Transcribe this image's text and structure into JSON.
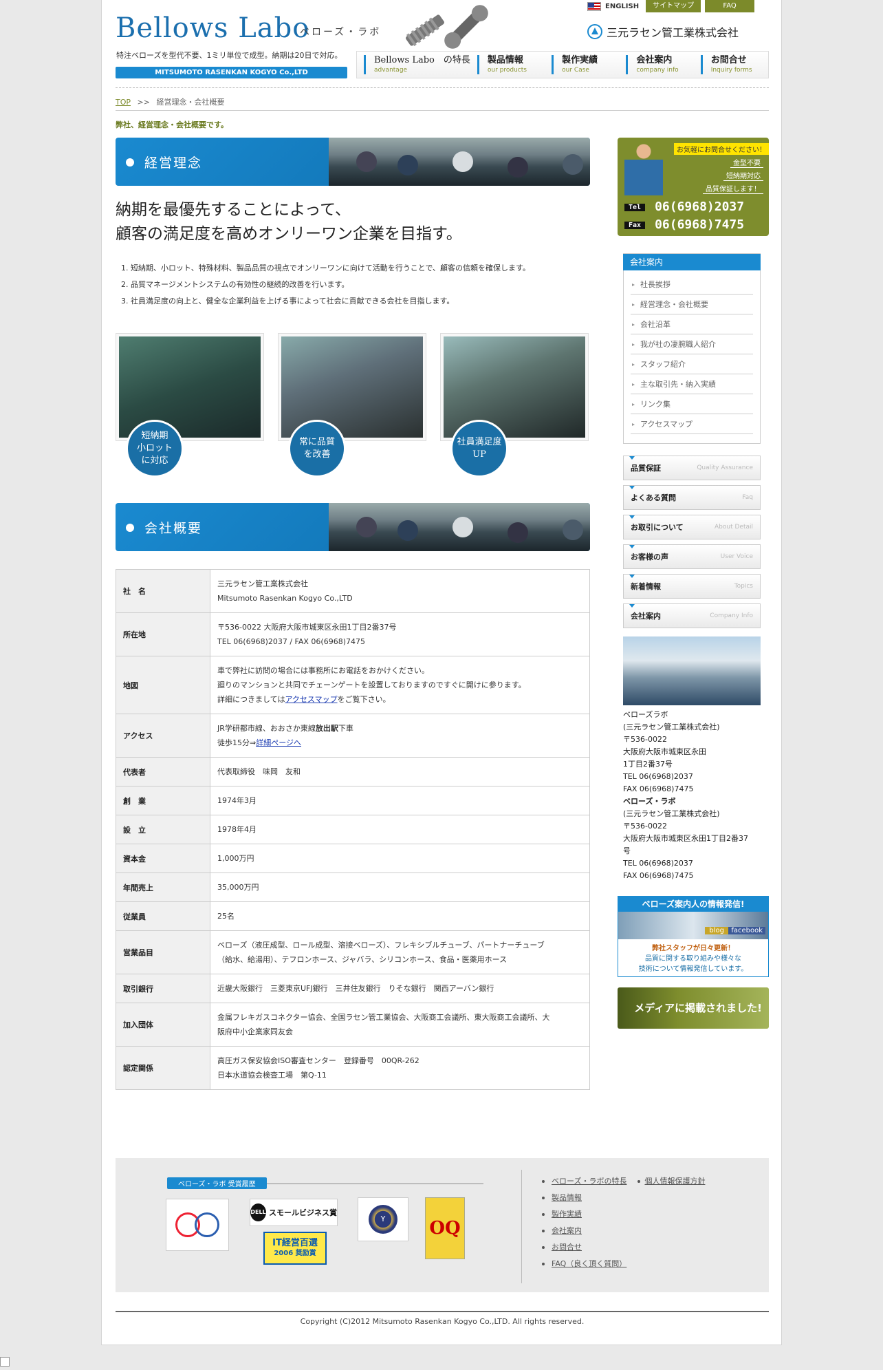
{
  "header": {
    "logo": "Bellows Labo",
    "logo_kana": "ベローズ・ラボ",
    "tagline": "特注ベローズを型代不要、1ミリ単位で成型。納期は20日で対応。",
    "company_en": "MITSUMOTO RASENKAN KOGYO Co.,LTD",
    "company_jp": "三元ラセン管工業株式会社",
    "top_links": {
      "english": "ENGLISH",
      "sitemap": "サイトマップ",
      "faq": "FAQ"
    },
    "nav": [
      {
        "jp": "Bellows Labo　の特長",
        "en": "advantage"
      },
      {
        "jp": "製品情報",
        "en": "our products"
      },
      {
        "jp": "製作実績",
        "en": "our Case"
      },
      {
        "jp": "会社案内",
        "en": "company info"
      },
      {
        "jp": "お問合せ",
        "en": "Inquiry forms"
      }
    ]
  },
  "breadcrumb": {
    "top": "TOP",
    "sep": ">>",
    "current": "経営理念・会社概要"
  },
  "intro": "弊社、経営理念・会社概要です。",
  "philosophy": {
    "heading": "経営理念",
    "title_line1": "納期を最優先することによって、",
    "title_line2": "顧客の満足度を高めオンリーワン企業を目指す。",
    "items": [
      "短納期、小ロット、特殊材料、製品品質の視点でオンリーワンに向けて活動を行うことで、顧客の信頼を確保します。",
      "品質マネージメントシステムの有効性の継続的改善を行います。",
      "社員満足度の向上と、健全な企業利益を上げる事によって社会に貢献できる会社を目指します。"
    ],
    "cards": [
      {
        "badge": "短納期\n小ロット\nに対応"
      },
      {
        "badge": "常に品質\nを改善"
      },
      {
        "badge": "社員満足度\nUP"
      }
    ]
  },
  "overview": {
    "heading": "会社概要",
    "rows": [
      {
        "label": "社　名",
        "lines": [
          "三元ラセン管工業株式会社",
          "Mitsumoto Rasenkan Kogyo Co.,LTD"
        ]
      },
      {
        "label": "所在地",
        "lines": [
          "〒536-0022 大阪府大阪市城東区永田1丁目2番37号",
          "TEL 06(6968)2037 / FAX 06(6968)7475"
        ]
      },
      {
        "label": "地図",
        "lines": [
          "車で弊社に訪問の場合には事務所にお電話をおかけください。",
          "廻りのマンションと共同でチェーンゲートを設置しておりますのですぐに開けに参ります。"
        ],
        "pre": "詳細につきましては",
        "link": "アクセスマップ",
        "post": "をご覧下さい。"
      },
      {
        "label": "アクセス",
        "line1_a": "JR学研都市線、おおさか東線",
        "line1_b": "放出駅",
        "line1_c": "下車",
        "line2_pre": "徒歩15分⇒",
        "line2_link": "詳細ページへ"
      },
      {
        "label": "代表者",
        "lines": [
          "代表取締役　味岡　友和"
        ]
      },
      {
        "label": "創　業",
        "lines": [
          "1974年3月"
        ]
      },
      {
        "label": "設　立",
        "lines": [
          "1978年4月"
        ]
      },
      {
        "label": "資本金",
        "lines": [
          "1,000万円"
        ]
      },
      {
        "label": "年間売上",
        "lines": [
          "35,000万円"
        ]
      },
      {
        "label": "従業員",
        "lines": [
          "25名"
        ]
      },
      {
        "label": "営業品目",
        "lines": [
          "ベローズ（液圧成型、ロール成型、溶接ベローズ）、フレキシブルチューブ、パートナーチューブ",
          "（給水、給湯用）、テフロンホース、ジャバラ、シリコンホース、食品・医薬用ホース"
        ]
      },
      {
        "label": "取引銀行",
        "lines": [
          "近畿大阪銀行　三菱東京UFJ銀行　三井住友銀行　りそな銀行　関西アーバン銀行"
        ]
      },
      {
        "label": "加入団体",
        "lines": [
          "金属フレキガスコネクター協会、全国ラセン管工業協会、大阪商工会議所、東大阪商工会議所、大",
          "阪府中小企業家同友会"
        ]
      },
      {
        "label": "認定関係",
        "lines": [
          "高圧ガス保安協会ISO審査センター　登録番号　00QR-262",
          "日本水道協会検査工場　第Q-11"
        ]
      }
    ]
  },
  "sidebar": {
    "contact": {
      "bubble": "お気軽にお問合せください！",
      "tags": [
        "金型不要",
        "短納期対応",
        "品質保証します！"
      ],
      "tel_label": "Tel",
      "tel": "06(6968)2037",
      "fax_label": "Fax",
      "fax": "06(6968)7475"
    },
    "subnav_title": "会社案内",
    "subnav": [
      "社長挨拶",
      "経営理念・会社概要",
      "会社沿革",
      "我が社の凄腕職人紹介",
      "スタッフ紹介",
      "主な取引先・納入実績",
      "リンク集",
      "アクセスマップ"
    ],
    "buttons": [
      {
        "jp": "品質保証",
        "en": "Quality Assurance"
      },
      {
        "jp": "よくある質問",
        "en": "Faq"
      },
      {
        "jp": "お取引について",
        "en": "About Detail"
      },
      {
        "jp": "お客様の声",
        "en": "User Voice"
      },
      {
        "jp": "新着情報",
        "en": "Topics"
      },
      {
        "jp": "会社案内",
        "en": "Company Info"
      }
    ],
    "address": [
      {
        "t": "ベローズラボ",
        "b": false
      },
      {
        "t": "(三元ラセン管工業株式会社)",
        "b": false
      },
      {
        "t": "〒536-0022",
        "b": false
      },
      {
        "t": "大阪府大阪市城東区永田",
        "b": false
      },
      {
        "t": "1丁目2番37号",
        "b": false
      },
      {
        "t": "TEL 06(6968)2037",
        "b": false
      },
      {
        "t": "FAX 06(6968)7475",
        "b": false
      },
      {
        "t": "ベローズ・ラボ",
        "b": true
      },
      {
        "t": "(三元ラセン管工業株式会社)",
        "b": false
      },
      {
        "t": "〒536-0022",
        "b": false
      },
      {
        "t": "大阪府大阪市城東区永田1丁目2番37",
        "b": false
      },
      {
        "t": "号",
        "b": false
      },
      {
        "t": "TEL 06(6968)2037",
        "b": false
      },
      {
        "t": "FAX 06(6968)7475",
        "b": false
      }
    ],
    "blog": {
      "title": "ベローズ案内人の情報発信!",
      "blog": "blog",
      "facebook": "facebook",
      "desc1": "弊社スタッフが日々更新！",
      "desc2": "品質に関する取り組みや様々な",
      "desc3": "技術について情報発信しています。"
    },
    "media": "メディアに掲載されました!"
  },
  "footer": {
    "award_label": "ベローズ・ラボ 受賞履歴",
    "award_dell": "スモールビジネス賞",
    "award_dell_logo": "DELL",
    "award_it1": "IT経営百選",
    "award_it2": "2006 奨励賞",
    "award_oq": "OQ",
    "links": [
      "ベローズ・ラボの特長",
      "製品情報",
      "製作実績",
      "会社案内",
      "お問合せ",
      "FAQ（良く頂く質問）"
    ],
    "privacy": "個人情報保護方針",
    "copyright": "Copyright (C)2012 Mitsumoto Rasenkan Kogyo Co.,LTD. All rights reserved."
  }
}
